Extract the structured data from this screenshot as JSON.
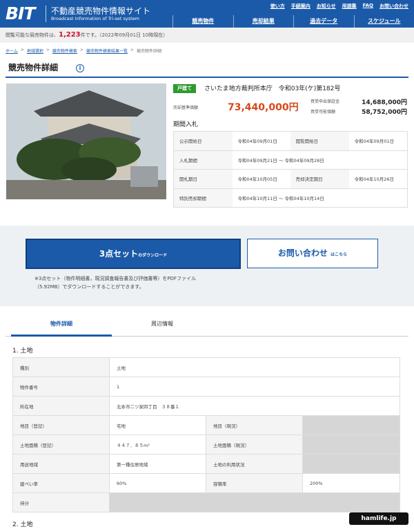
{
  "header": {
    "logo": "BIT",
    "site_title": "不動産競売物件情報サイト",
    "site_subtitle": "Broadcast Information of Tri-set system",
    "util_links": [
      "使い方",
      "手続案内",
      "お知らせ",
      "用語集",
      "FAQ",
      "お問い合わせ"
    ],
    "main_nav": [
      "競売物件",
      "売却結果",
      "過去データ",
      "スケジュール"
    ]
  },
  "countbar": {
    "prefix": "閲覧可能な競売物件は、",
    "count": "1,223",
    "suffix": "件です。（2022年09月01日 10時現在）"
  },
  "breadcrumb": [
    "ホーム",
    "地域選択",
    "競売物件検索",
    "競売物件検索結果一覧",
    "競売物件詳細"
  ],
  "page_title": "競売物件詳細",
  "info_icon": "i",
  "property": {
    "type_badge": "戸建て",
    "court_case": "さいたま地方裁判所本庁　令和03年(ケ)第182号",
    "price_label": "売却基準価額",
    "price": "73,440,000円",
    "deposit_label": "買受申出保証金",
    "deposit": "14,688,000円",
    "min_label": "買受可能価額",
    "min_price": "58,752,000円",
    "method": "期間入札"
  },
  "schedule": [
    [
      "公示開始日",
      "令和04年09月01日",
      "閲覧開始日",
      "令和04年09月01日"
    ],
    [
      "入札期間",
      "令和04年09月21日 〜 令和04年09月28日"
    ],
    [
      "開札期日",
      "令和04年10月05日",
      "売却決定期日",
      "令和04年10月26日"
    ],
    [
      "特別売却期間",
      "令和04年10月11日 〜 令和04年10月14日"
    ]
  ],
  "download": {
    "button_main": "3点セット",
    "button_small": "のダウンロード",
    "contact_main": "お問い合わせ",
    "contact_small": "はこちら",
    "note_line1": "※3点セット（物件明細書，現況調査報告書及び評価書等）をPDFファイル",
    "note_line2": "（5.92MB）でダウンロードすることができます。"
  },
  "tabs": [
    "物件詳細",
    "周辺情報"
  ],
  "sections": [
    "1. 土地",
    "2. 土地"
  ],
  "land_rows": [
    [
      "種別",
      "土地"
    ],
    [
      "物件番号",
      "1"
    ],
    [
      "所在地",
      "北本市二ツ家四丁目　３８番１"
    ],
    [
      "地目（登記）",
      "宅地",
      "地目（現況）",
      ""
    ],
    [
      "土地面積（登記）",
      "４４７．８５m²",
      "土地面積（現況）",
      ""
    ],
    [
      "用途地域",
      "第一種住居地域",
      "土地の利用状況",
      ""
    ],
    [
      "建ぺい率",
      "60%",
      "容積率",
      "200%"
    ],
    [
      "持分",
      ""
    ]
  ],
  "watermark": "hamlife.jp",
  "colors": {
    "brand": "#1b5aa8",
    "price": "#d6491a",
    "badge": "#2e9a2e",
    "count": "#c8102e"
  }
}
